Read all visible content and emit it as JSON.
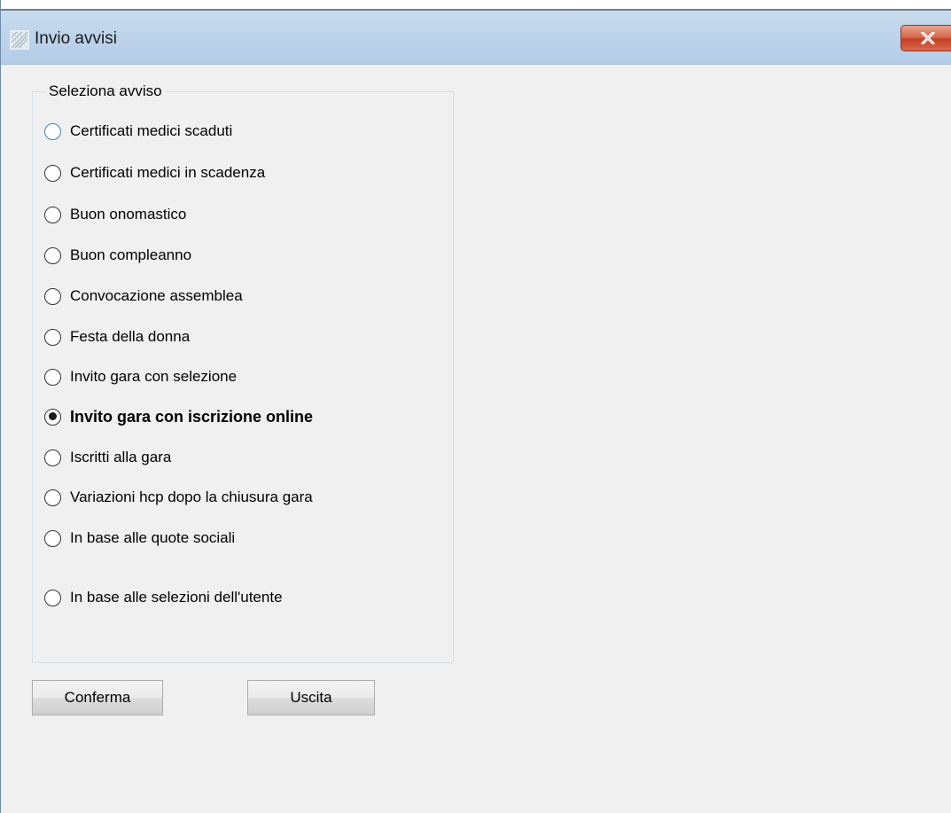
{
  "window": {
    "title": "Invio avvisi",
    "close_icon": "close-icon"
  },
  "group": {
    "legend": "Seleziona avviso",
    "options": [
      {
        "label": "Certificati medici scaduti",
        "checked": false,
        "focused": true
      },
      {
        "label": "Certificati medici in scadenza",
        "checked": false
      },
      {
        "label": "Buon onomastico",
        "checked": false
      },
      {
        "label": "Buon compleanno",
        "checked": false
      },
      {
        "label": "Convocazione assemblea",
        "checked": false
      },
      {
        "label": "Festa della donna",
        "checked": false
      },
      {
        "label": "Invito gara con selezione",
        "checked": false
      },
      {
        "label": "Invito gara con iscrizione online",
        "checked": true
      },
      {
        "label": "Iscritti alla gara",
        "checked": false
      },
      {
        "label": "Variazioni hcp dopo la chiusura gara",
        "checked": false
      },
      {
        "label": "In base alle quote sociali",
        "checked": false
      },
      {
        "label": "In base alle selezioni dell'utente",
        "checked": false
      }
    ]
  },
  "buttons": {
    "confirm_label": "Conferma",
    "exit_label": "Uscita"
  },
  "colors": {
    "titlebar": "#bdd3ea",
    "close_button": "#c4412a",
    "focus_ring": "#3c7fb1",
    "background": "#f0f0f0"
  }
}
